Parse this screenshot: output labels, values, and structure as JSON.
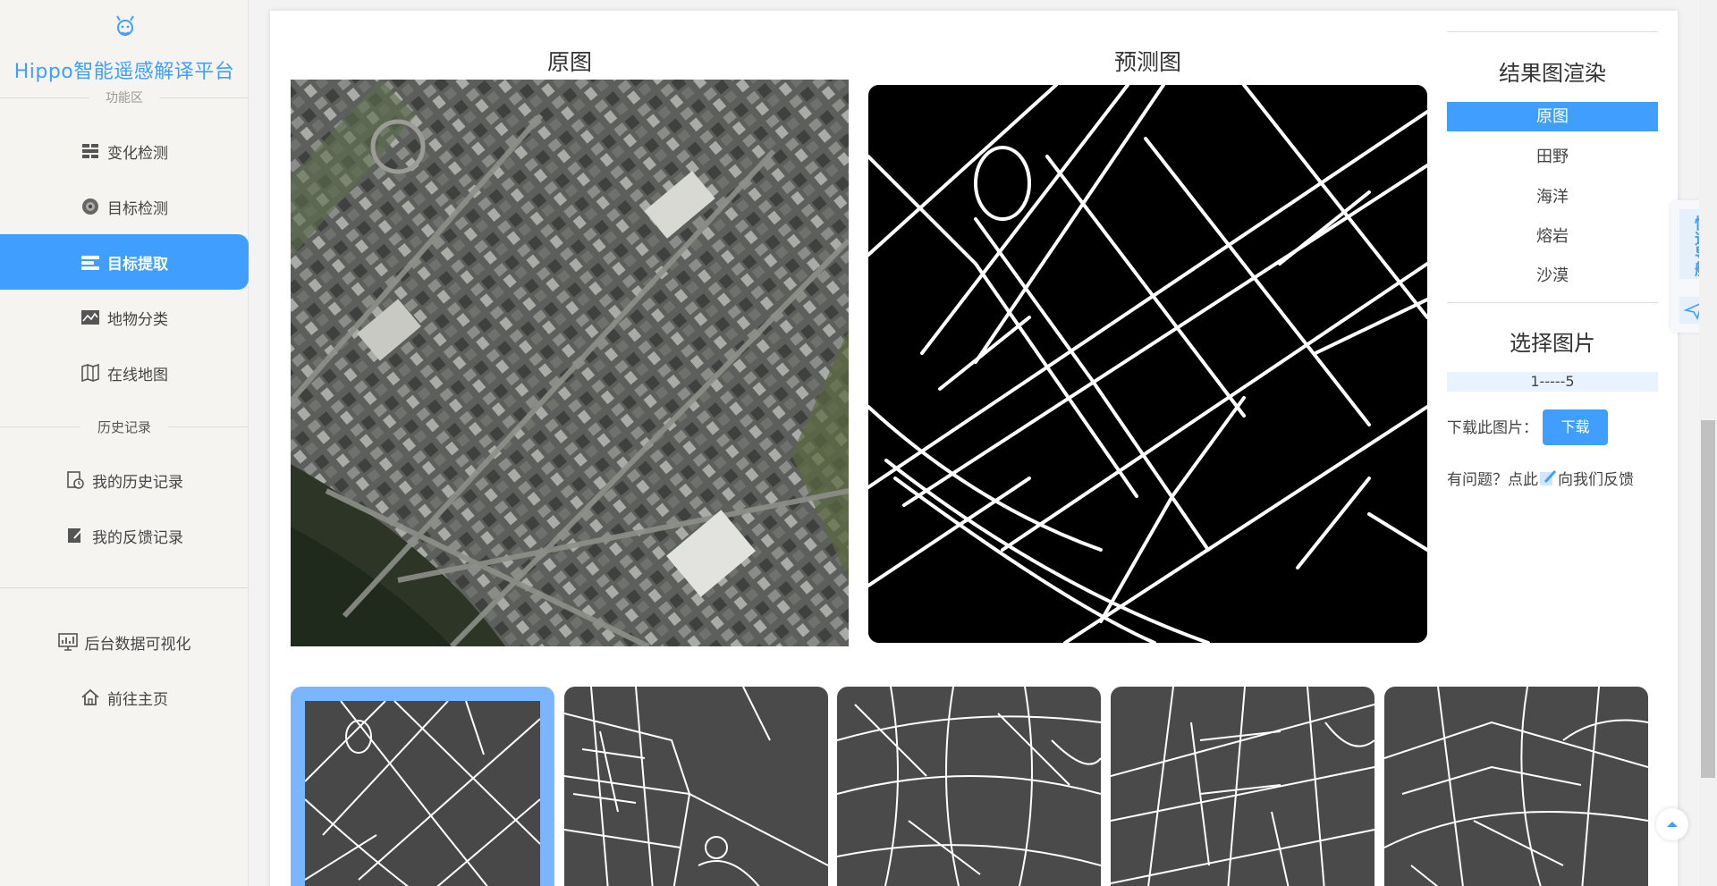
{
  "sidebar": {
    "brand": "Hippo智能遥感解译平台",
    "section_function": "功能区",
    "items": [
      {
        "label": "变化检测",
        "icon": "change-detection-icon"
      },
      {
        "label": "目标检测",
        "icon": "target-detection-icon"
      },
      {
        "label": "目标提取",
        "icon": "target-extraction-icon"
      },
      {
        "label": "地物分类",
        "icon": "terrain-classification-icon"
      },
      {
        "label": "在线地图",
        "icon": "online-map-icon"
      }
    ],
    "section_history": "历史记录",
    "history_items": [
      {
        "label": "我的历史记录",
        "icon": "history-icon"
      },
      {
        "label": "我的反馈记录",
        "icon": "feedback-edit-icon"
      }
    ],
    "bottom_items": [
      {
        "label": "后台数据可视化",
        "icon": "dashboard-chart-icon"
      },
      {
        "label": "前往主页",
        "icon": "home-icon"
      }
    ],
    "active_index": 2
  },
  "main": {
    "original_title": "原图",
    "predicted_title": "预测图"
  },
  "render_panel": {
    "title": "结果图渲染",
    "options": [
      "原图",
      "田野",
      "海洋",
      "熔岩",
      "沙漠"
    ],
    "selected": "原图"
  },
  "select_panel": {
    "title": "选择图片",
    "range": "1-----5",
    "download_label": "下载此图片：",
    "download_button": "下载",
    "feedback_prefix": "有问题？点此",
    "feedback_suffix": "向我们反馈"
  },
  "thumbnails": {
    "count": 5,
    "selected_index": 0
  },
  "quick_nav": {
    "label": "快速导航"
  },
  "colors": {
    "accent": "#409eff",
    "sidebar_bg": "#f5f4f0",
    "thumb_bg": "#4a4a4a",
    "thumb_selected": "#7ab6ff"
  }
}
